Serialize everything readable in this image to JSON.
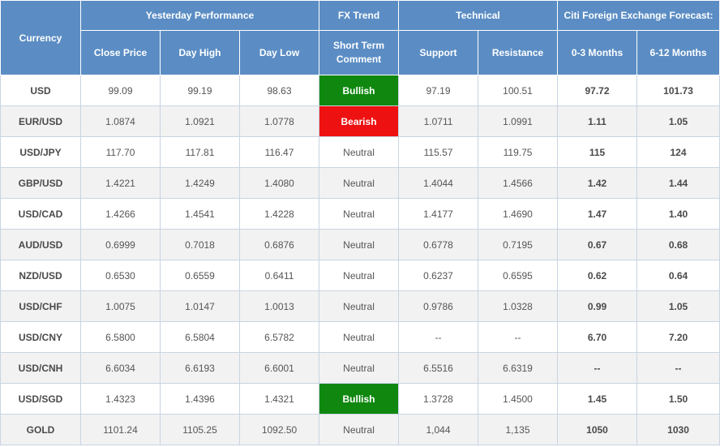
{
  "headers": {
    "currency": "Currency",
    "yesterday": "Yesterday Performance",
    "fx_trend": "FX Trend",
    "technical": "Technical",
    "forecast": "Citi Foreign Exchange Forecast:",
    "close": "Close Price",
    "day_high": "Day High",
    "day_low": "Day Low",
    "short_term": "Short Term Comment",
    "support": "Support",
    "resistance": "Resistance",
    "m0_3": "0-3 Months",
    "m6_12": "6-12 Months"
  },
  "trend_colors": {
    "Bullish": "#108810",
    "Bearish": "#ee1111"
  },
  "rows": [
    {
      "currency": "USD",
      "close": "99.09",
      "high": "99.19",
      "low": "98.63",
      "trend": "Bullish",
      "support": "97.19",
      "resistance": "100.51",
      "f0_3": "97.72",
      "f6_12": "101.73"
    },
    {
      "currency": "EUR/USD",
      "close": "1.0874",
      "high": "1.0921",
      "low": "1.0778",
      "trend": "Bearish",
      "support": "1.0711",
      "resistance": "1.0991",
      "f0_3": "1.11",
      "f6_12": "1.05"
    },
    {
      "currency": "USD/JPY",
      "close": "117.70",
      "high": "117.81",
      "low": "116.47",
      "trend": "Neutral",
      "support": "115.57",
      "resistance": "119.75",
      "f0_3": "115",
      "f6_12": "124"
    },
    {
      "currency": "GBP/USD",
      "close": "1.4221",
      "high": "1.4249",
      "low": "1.4080",
      "trend": "Neutral",
      "support": "1.4044",
      "resistance": "1.4566",
      "f0_3": "1.42",
      "f6_12": "1.44"
    },
    {
      "currency": "USD/CAD",
      "close": "1.4266",
      "high": "1.4541",
      "low": "1.4228",
      "trend": "Neutral",
      "support": "1.4177",
      "resistance": "1.4690",
      "f0_3": "1.47",
      "f6_12": "1.40"
    },
    {
      "currency": "AUD/USD",
      "close": "0.6999",
      "high": "0.7018",
      "low": "0.6876",
      "trend": "Neutral",
      "support": "0.6778",
      "resistance": "0.7195",
      "f0_3": "0.67",
      "f6_12": "0.68"
    },
    {
      "currency": "NZD/USD",
      "close": "0.6530",
      "high": "0.6559",
      "low": "0.6411",
      "trend": "Neutral",
      "support": "0.6237",
      "resistance": "0.6595",
      "f0_3": "0.62",
      "f6_12": "0.64"
    },
    {
      "currency": "USD/CHF",
      "close": "1.0075",
      "high": "1.0147",
      "low": "1.0013",
      "trend": "Neutral",
      "support": "0.9786",
      "resistance": "1.0328",
      "f0_3": "0.99",
      "f6_12": "1.05"
    },
    {
      "currency": "USD/CNY",
      "close": "6.5800",
      "high": "6.5804",
      "low": "6.5782",
      "trend": "Neutral",
      "support": "--",
      "resistance": "--",
      "f0_3": "6.70",
      "f6_12": "7.20"
    },
    {
      "currency": "USD/CNH",
      "close": "6.6034",
      "high": "6.6193",
      "low": "6.6001",
      "trend": "Neutral",
      "support": "6.5516",
      "resistance": "6.6319",
      "f0_3": "--",
      "f6_12": "--"
    },
    {
      "currency": "USD/SGD",
      "close": "1.4323",
      "high": "1.4396",
      "low": "1.4321",
      "trend": "Bullish",
      "support": "1.3728",
      "resistance": "1.4500",
      "f0_3": "1.45",
      "f6_12": "1.50"
    },
    {
      "currency": "GOLD",
      "close": "1101.24",
      "high": "1105.25",
      "low": "1092.50",
      "trend": "Neutral",
      "support": "1,044",
      "resistance": "1,135",
      "f0_3": "1050",
      "f6_12": "1030"
    }
  ]
}
